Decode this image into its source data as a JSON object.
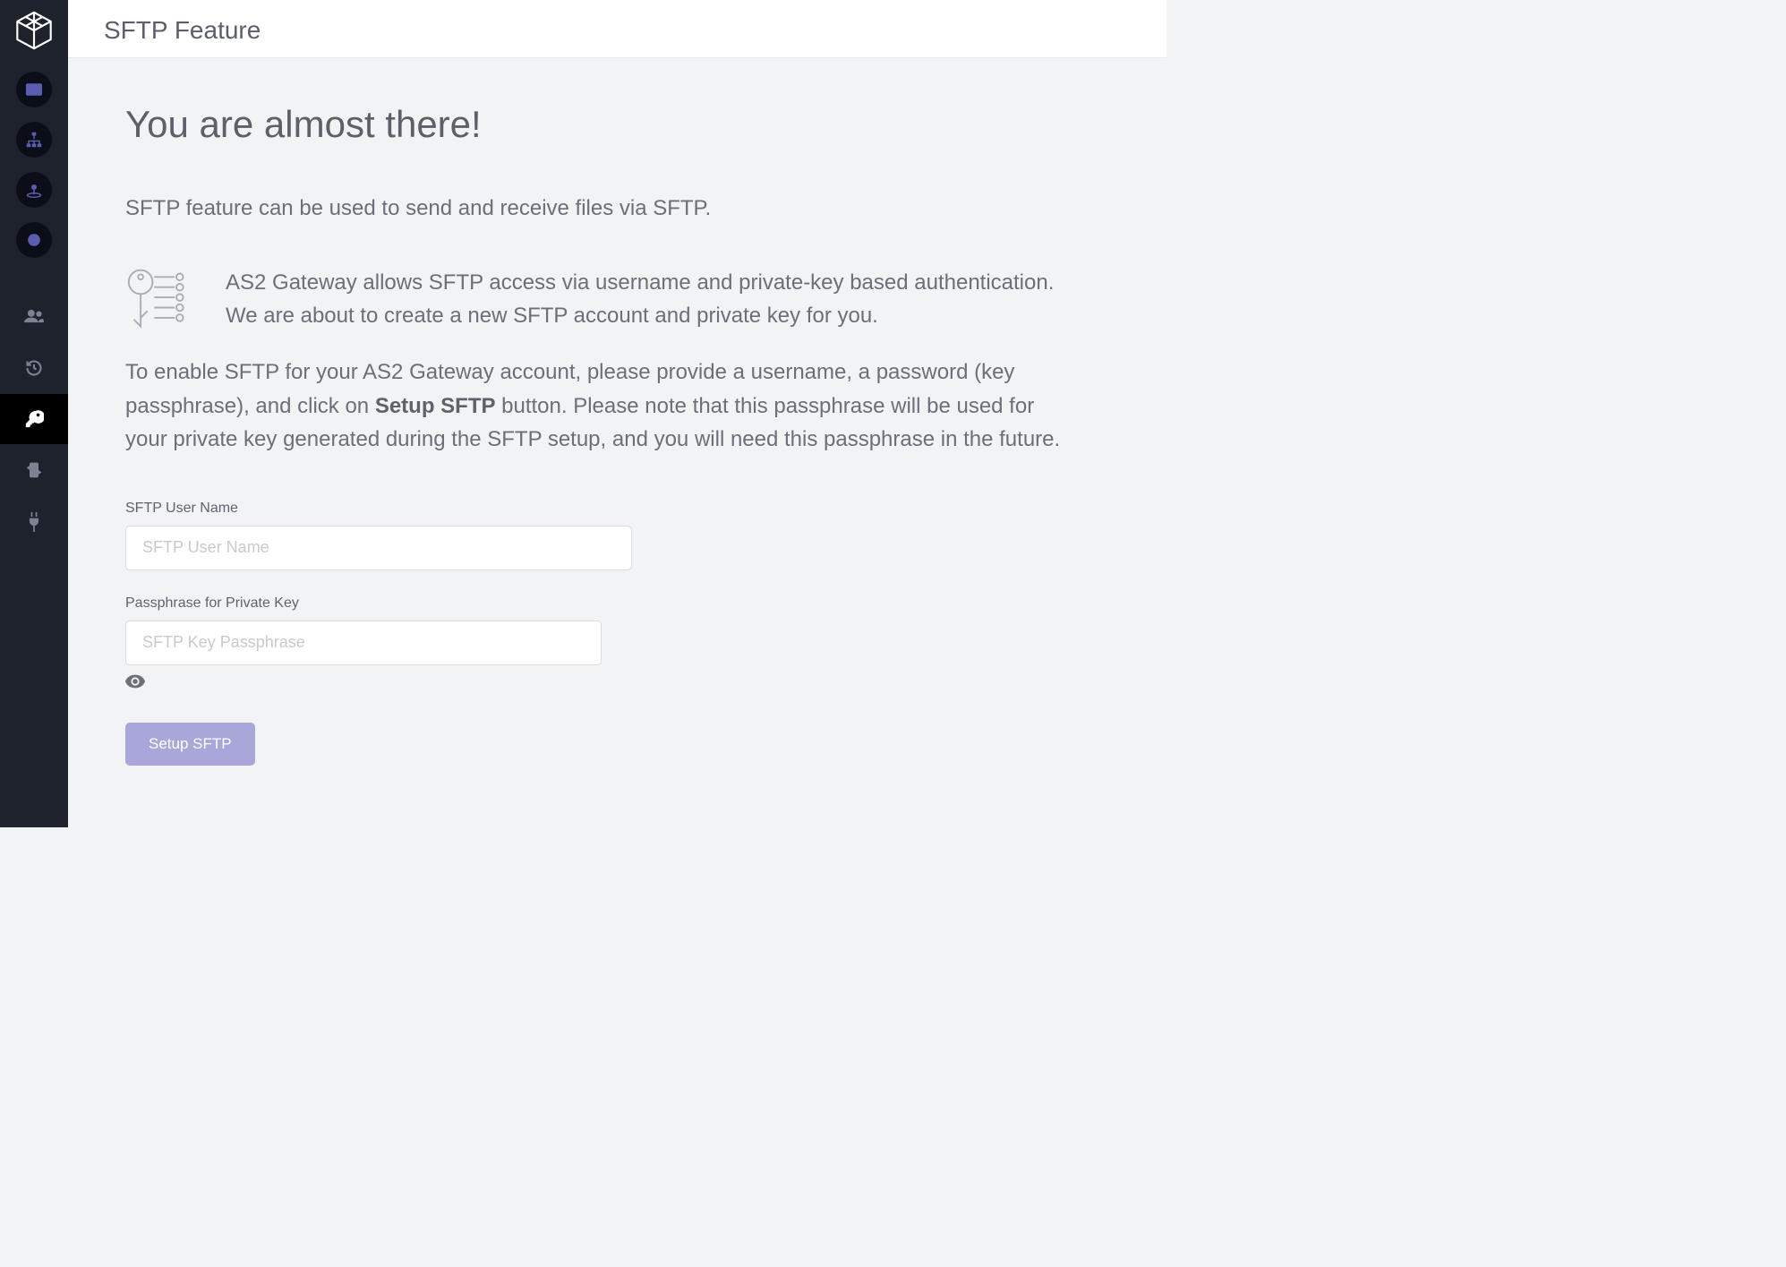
{
  "header": {
    "title": "SFTP Feature"
  },
  "hero": "You are almost there!",
  "lead": "SFTP feature can be used to send and receive files via SFTP.",
  "info": {
    "line1": "AS2 Gateway allows SFTP access via username and private-key based authentication. We are about to create a new SFTP account and private key for you.",
    "line2_pre": "To enable SFTP for your AS2 Gateway account, please provide a username, a password (key passphrase), and click on ",
    "line2_bold": "Setup SFTP",
    "line2_post": " button. Please note that this passphrase will be used for your private key generated during the SFTP setup, and you will need this passphrase in the future."
  },
  "form": {
    "username_label": "SFTP User Name",
    "username_placeholder": "SFTP User Name",
    "passphrase_label": "Passphrase for Private Key",
    "passphrase_placeholder": "SFTP Key Passphrase",
    "submit": "Setup SFTP"
  },
  "sidebar": {
    "items": [
      {
        "name": "mail-icon"
      },
      {
        "name": "sitemap-icon"
      },
      {
        "name": "person-pin-icon"
      },
      {
        "name": "certificate-icon"
      },
      {
        "name": "users-icon"
      },
      {
        "name": "history-icon"
      },
      {
        "name": "key-icon",
        "active": true
      },
      {
        "name": "exchange-icon"
      },
      {
        "name": "plug-icon"
      }
    ]
  }
}
